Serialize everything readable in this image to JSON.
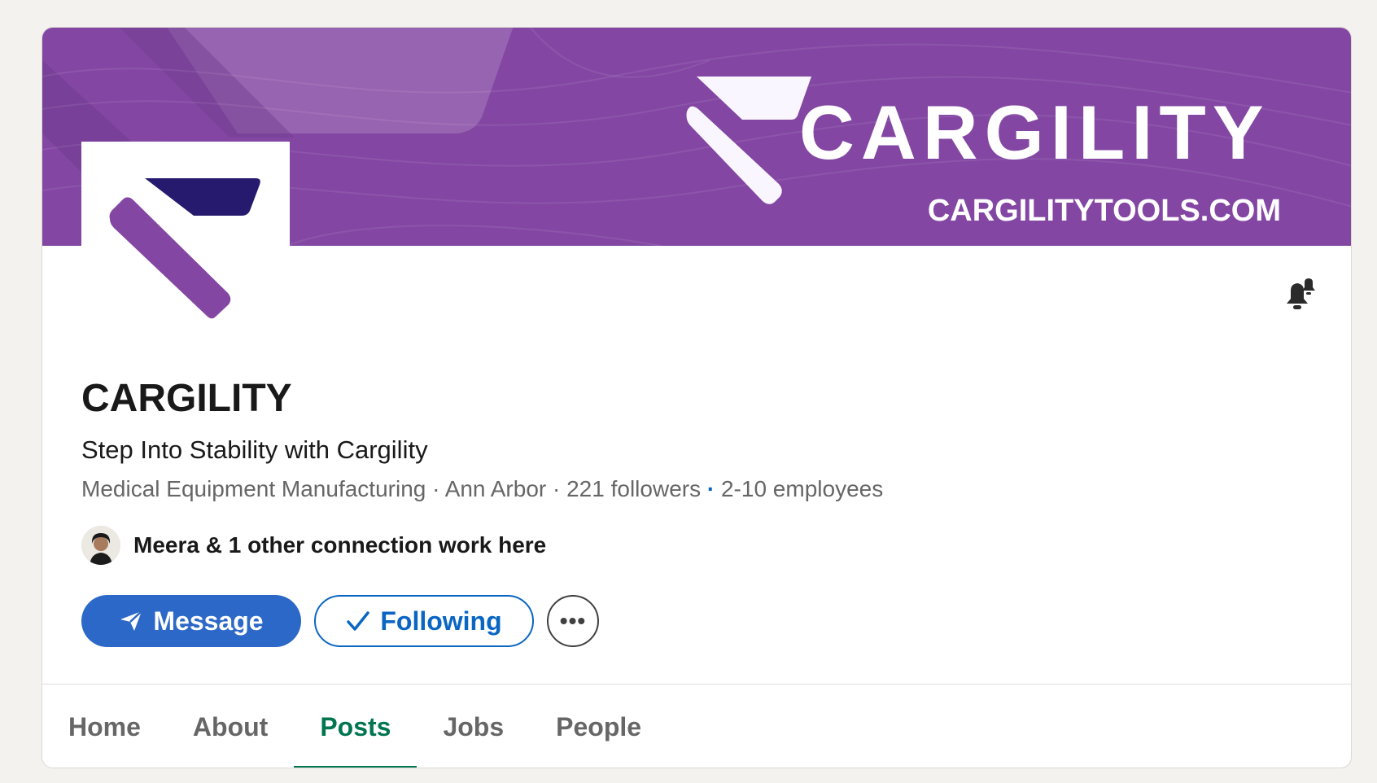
{
  "banner": {
    "brand": "CARGILITY",
    "url": "CARGILITYTOOLS.COM",
    "background_color": "#8347a3"
  },
  "company": {
    "name": "CARGILITY",
    "tagline": "Step Into Stability with Cargility",
    "industry": "Medical Equipment Manufacturing",
    "location": "Ann Arbor",
    "followers": "221 followers",
    "employees": "2-10 employees",
    "separator": "·",
    "logo_colors": [
      "#8347a3",
      "#261a6e"
    ]
  },
  "notifications": {
    "icon": "bell-plus-icon"
  },
  "connection": {
    "text": "Meera & 1 other connection work here",
    "avatar_icon": "avatar"
  },
  "actions": {
    "message_label": "Message",
    "message_icon": "send-icon",
    "following_label": "Following",
    "following_icon": "checkmark-icon",
    "more_label": "•••",
    "primary_color": "#2c68c7"
  },
  "tabs": [
    {
      "label": "Home",
      "active": false
    },
    {
      "label": "About",
      "active": false
    },
    {
      "label": "Posts",
      "active": true
    },
    {
      "label": "Jobs",
      "active": false
    },
    {
      "label": "People",
      "active": false
    }
  ],
  "active_tab_color": "#01754f"
}
